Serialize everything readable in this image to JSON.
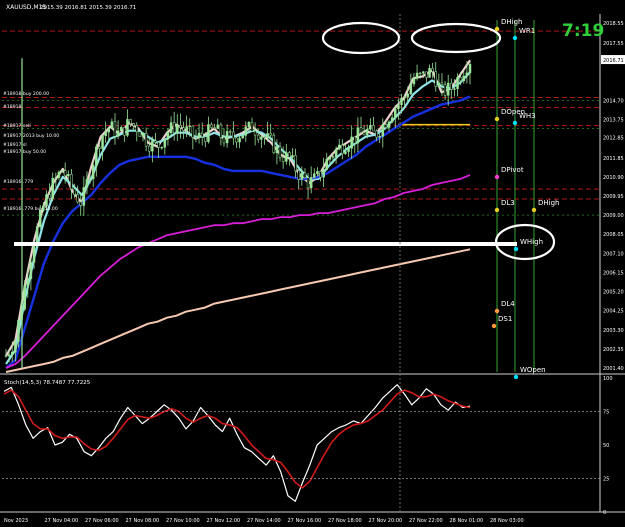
{
  "window": {
    "symbol_title": "XAUUSD,M15",
    "ohlc_readout": "2015.39 2016.81 2015.39 2016.71",
    "countdown": "7:19",
    "current_price_tag": "2016.71"
  },
  "colors": {
    "background": "#000000",
    "candle": "#9ae59a",
    "ema_fast": "#f2d0d0",
    "ema_cyan": "#8fe3e8",
    "ma_blue": "#1730e0",
    "ma_magenta": "#d81ed8",
    "ma_peach": "#f7c9b0",
    "level_red": "#b01818",
    "level_green": "#2b8a2b",
    "dopen_yellow": "#e6d21e",
    "countdown_green": "#2fcf3a",
    "stoch_main": "#ffffff",
    "stoch_signal": "#d11a1a",
    "annotation": "#ffffff"
  },
  "order_labels": [
    "#18918 buy 200.00",
    "#18918 ",
    "#18917 sell",
    "#18917 2013 buy 10.00",
    "#18917 sl",
    "#18917 buy 50.00",
    "#18916 .779",
    "#18916 .779 buy 50.00"
  ],
  "level_labels": [
    {
      "text": "DHigh",
      "color": "#e6d21e"
    },
    {
      "text": "WR1",
      "color": "#00e0ff"
    },
    {
      "text": "DOpen",
      "color": "#e6d21e"
    },
    {
      "text": "WH3",
      "color": "#00e0ff"
    },
    {
      "text": "DPivot",
      "color": "#ff3fd0"
    },
    {
      "text": "DL3",
      "color": "#e6d21e"
    },
    {
      "text": "DHigh",
      "color": "#e6d21e"
    },
    {
      "text": "WHigh",
      "color": "#00e0ff"
    },
    {
      "text": "DL4",
      "color": "#ff9a3a"
    },
    {
      "text": "DS1",
      "color": "#ff9a3a"
    },
    {
      "text": "WOpen",
      "color": "#00e0ff"
    }
  ],
  "stochastic": {
    "label": "Stoch(14,5,3) 78.7487 77.7225"
  },
  "chart_data": [
    {
      "type": "candlestick",
      "title": "XAUUSD,M15",
      "x_tick_labels": [
        "Nov 2023",
        "27 Nov 04:00",
        "27 Nov 06:00",
        "27 Nov 08:00",
        "27 Nov 10:00",
        "27 Nov 12:00",
        "27 Nov 14:00",
        "27 Nov 16:00",
        "27 Nov 18:00",
        "27 Nov 20:00",
        "27 Nov 22:00",
        "28 Nov 01:00",
        "28 Nov 03:00"
      ],
      "y_tick_labels": [
        "2018.55",
        "2017.55",
        "2016.71",
        "2014.70",
        "2013.75",
        "2012.85",
        "2011.85",
        "2010.90",
        "2009.95",
        "2009.00",
        "2008.05",
        "2007.10",
        "2006.15",
        "2005.20",
        "2004.25",
        "2003.30",
        "2002.35",
        "2001.40"
      ],
      "ylim": [
        2001.2,
        2019.0
      ],
      "grid": false,
      "series": [
        {
          "name": "",
          "values": [
            2002.0,
            2002.8,
            2005.5,
            2007.8,
            2009.5,
            2010.6,
            2011.3,
            2010.2,
            2009.6,
            2011.4,
            2012.9,
            2013.4,
            2013.0,
            2013.6,
            2013.3,
            2012.6,
            2012.4,
            2013.1,
            2013.5,
            2013.2,
            2012.8,
            2013.0,
            2013.3,
            2012.8,
            2012.9,
            2013.1,
            2013.4,
            2013.0,
            2012.6,
            2012.0,
            2011.8,
            2011.0,
            2010.6,
            2010.9,
            2011.8,
            2012.3,
            2012.6,
            2012.9,
            2013.2,
            2013.0,
            2013.6,
            2014.3,
            2014.8,
            2015.8,
            2015.9,
            2016.2,
            2015.1,
            2015.3,
            2016.0,
            2016.7
          ]
        },
        {
          "name": "",
          "values": [
            2001.6,
            2002.3,
            2004.8,
            2006.9,
            2008.7,
            2010.0,
            2010.9,
            2010.5,
            2010.0,
            2010.8,
            2012.0,
            2012.8,
            2013.0,
            2013.2,
            2013.2,
            2012.9,
            2012.6,
            2012.8,
            2013.1,
            2013.1,
            2012.9,
            2012.9,
            2013.1,
            2012.9,
            2012.9,
            2013.0,
            2013.2,
            2013.1,
            2012.8,
            2012.3,
            2011.9,
            2011.3,
            2010.8,
            2010.8,
            2011.4,
            2011.9,
            2012.3,
            2012.6,
            2012.9,
            2013.0,
            2013.3,
            2013.8,
            2014.3,
            2015.0,
            2015.4,
            2015.7,
            2015.4,
            2015.3,
            2015.6,
            2016.1
          ]
        },
        {
          "name": "",
          "values": [
            2001.4,
            2001.8,
            2003.4,
            2005.0,
            2006.6,
            2007.7,
            2008.6,
            2009.2,
            2009.6,
            2010.0,
            2010.6,
            2011.1,
            2011.5,
            2011.7,
            2011.8,
            2011.9,
            2011.9,
            2011.9,
            2011.9,
            2011.9,
            2011.8,
            2011.6,
            2011.5,
            2011.3,
            2011.2,
            2011.2,
            2011.2,
            2011.2,
            2011.1,
            2011.0,
            2010.9,
            2010.8,
            2010.8,
            2010.9,
            2011.1,
            2011.4,
            2011.7,
            2012.0,
            2012.4,
            2012.7,
            2013.0,
            2013.3,
            2013.6,
            2013.9,
            2014.1,
            2014.3,
            2014.5,
            2014.6,
            2014.7,
            2014.9
          ]
        },
        {
          "name": "",
          "values": [
            2001.4,
            2001.6,
            2002.0,
            2002.5,
            2003.0,
            2003.5,
            2004.0,
            2004.5,
            2005.0,
            2005.5,
            2006.0,
            2006.4,
            2006.8,
            2007.1,
            2007.4,
            2007.6,
            2007.8,
            2008.0,
            2008.1,
            2008.2,
            2008.3,
            2008.4,
            2008.5,
            2008.5,
            2008.6,
            2008.6,
            2008.7,
            2008.8,
            2008.8,
            2008.9,
            2008.9,
            2009.0,
            2009.0,
            2009.1,
            2009.1,
            2009.2,
            2009.3,
            2009.4,
            2009.5,
            2009.6,
            2009.8,
            2009.9,
            2010.1,
            2010.2,
            2010.3,
            2010.5,
            2010.6,
            2010.7,
            2010.8,
            2011.0
          ]
        },
        {
          "name": "",
          "values": [
            2001.2,
            2001.3,
            2001.4,
            2001.5,
            2001.6,
            2001.7,
            2001.9,
            2002.0,
            2002.2,
            2002.4,
            2002.6,
            2002.8,
            2003.0,
            2003.2,
            2003.4,
            2003.6,
            2003.7,
            2003.9,
            2004.0,
            2004.2,
            2004.3,
            2004.4,
            2004.6,
            2004.7,
            2004.8,
            2004.9,
            2005.0,
            2005.1,
            2005.2,
            2005.3,
            2005.4,
            2005.5,
            2005.6,
            2005.7,
            2005.8,
            2005.9,
            2006.0,
            2006.1,
            2006.2,
            2006.3,
            2006.4,
            2006.5,
            2006.6,
            2006.7,
            2006.8,
            2006.9,
            2007.0,
            2007.1,
            2007.2,
            2007.3
          ]
        }
      ],
      "price_levels_red_dashed": [
        2018.15,
        2014.85,
        2014.35,
        2013.45,
        2010.3,
        2009.8
      ],
      "price_levels_green": [
        2014.7,
        2013.3,
        2009.0
      ],
      "dopen_segment": {
        "value": 2013.5
      }
    },
    {
      "type": "line",
      "title": "",
      "ylim": [
        0,
        100
      ],
      "y_tick_labels": [
        "100",
        "75",
        "50",
        "25",
        "0"
      ],
      "levels": [
        75,
        25
      ],
      "series": [
        {
          "name": "",
          "values": [
            90,
            93,
            80,
            65,
            55,
            60,
            63,
            50,
            52,
            58,
            55,
            45,
            42,
            48,
            55,
            60,
            70,
            78,
            72,
            66,
            70,
            75,
            80,
            76,
            70,
            62,
            68,
            78,
            72,
            65,
            60,
            70,
            58,
            48,
            45,
            40,
            35,
            42,
            30,
            12,
            8,
            22,
            35,
            50,
            55,
            60,
            63,
            65,
            68,
            66,
            72,
            78,
            85,
            90,
            95,
            88,
            80,
            85,
            92,
            88,
            80,
            76,
            82,
            78,
            79
          ]
        },
        {
          "name": "",
          "values": [
            88,
            91,
            86,
            76,
            66,
            62,
            62,
            57,
            55,
            56,
            56,
            51,
            47,
            46,
            49,
            55,
            62,
            69,
            72,
            71,
            70,
            72,
            75,
            77,
            75,
            70,
            67,
            70,
            72,
            70,
            66,
            65,
            63,
            57,
            50,
            45,
            40,
            39,
            37,
            30,
            22,
            18,
            23,
            33,
            43,
            52,
            58,
            62,
            65,
            66,
            68,
            72,
            76,
            82,
            88,
            91,
            89,
            86,
            86,
            88,
            86,
            83,
            81,
            79,
            78
          ]
        }
      ]
    }
  ]
}
